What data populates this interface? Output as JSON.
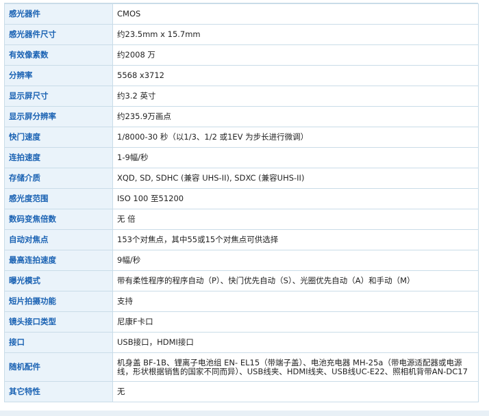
{
  "specs": [
    {
      "label": "感光器件",
      "value": "CMOS"
    },
    {
      "label": "感光器件尺寸",
      "value": "约23.5mm x 15.7mm"
    },
    {
      "label": "有效像素数",
      "value": "约2008 万"
    },
    {
      "label": "分辨率",
      "value": "5568 x3712"
    },
    {
      "label": "显示屏尺寸",
      "value": "约3.2 英寸"
    },
    {
      "label": "显示屏分辨率",
      "value": "约235.9万画点"
    },
    {
      "label": "快门速度",
      "value": "1/8000-30 秒（以1/3、1/2 或1EV 为步长进行微调）"
    },
    {
      "label": "连拍速度",
      "value": "1-9幅/秒"
    },
    {
      "label": "存储介质",
      "value": "XQD, SD, SDHC (兼容 UHS-II), SDXC (兼容UHS-II)"
    },
    {
      "label": "感光度范围",
      "value": "ISO 100 至51200"
    },
    {
      "label": "数码变焦倍数",
      "value": "无 倍"
    },
    {
      "label": "自动对焦点",
      "value": "153个对焦点，其中55或15个对焦点可供选择"
    },
    {
      "label": "最高连拍速度",
      "value": "9幅/秒"
    },
    {
      "label": "曝光模式",
      "value": "带有柔性程序的程序自动（P）、快门优先自动（S）、光圈优先自动（A）和手动（M）"
    },
    {
      "label": "短片拍摄功能",
      "value": "支持"
    },
    {
      "label": "镜头接口类型",
      "value": "尼康F卡口"
    },
    {
      "label": "接口",
      "value": "USB接口，HDMI接口"
    },
    {
      "label": "随机配件",
      "value": "机身盖 BF-1B、锂离子电池组 EN- EL15（带端子盖）、电池充电器 MH-25a（带电源适配器或电源线，形状根据销售的国家不同而异）、USB线夹、HDMI线夹、USB线UC-E22、照相机背带AN-DC17"
    },
    {
      "label": "其它特性",
      "value": "无"
    }
  ]
}
